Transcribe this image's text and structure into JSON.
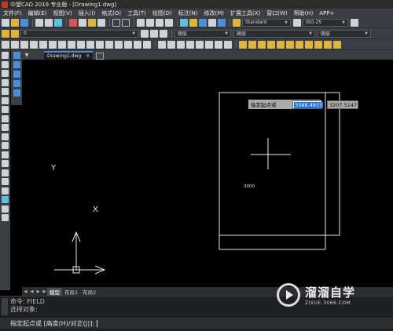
{
  "window": {
    "title": "中望CAD 2019 专业版 - [Drawing1.dwg]"
  },
  "menu": [
    "文件(F)",
    "编辑(E)",
    "视图(V)",
    "插入(I)",
    "格式(O)",
    "工具(T)",
    "绘图(D)",
    "标注(N)",
    "修改(M)",
    "扩展工具(X)",
    "窗口(W)",
    "帮助(H)",
    "APP+"
  ],
  "toolbar": {
    "text_style": "Standard",
    "dim_style": "ISO-25",
    "layer": "0",
    "color": "随层",
    "linetype": "随层",
    "lineweight": "随层"
  },
  "tabs": {
    "document": "Drawing1.dwg"
  },
  "drawing": {
    "dynamic_prompt": "指定起点或",
    "x_value": "3388.4915",
    "y_value": "3207.5147",
    "dimension_text": "3000",
    "ucs_x": "X",
    "ucs_y": "Y"
  },
  "layout_tabs": [
    "模型",
    "布局1",
    "布局2"
  ],
  "command": {
    "history": [
      "命令: FIELD",
      "选择对象:"
    ],
    "prompt": "指定起点或 [高度(H)/对正(J)]:"
  },
  "watermark": {
    "title": "溜溜自学",
    "url": "ZIXUE.3066.COM"
  }
}
